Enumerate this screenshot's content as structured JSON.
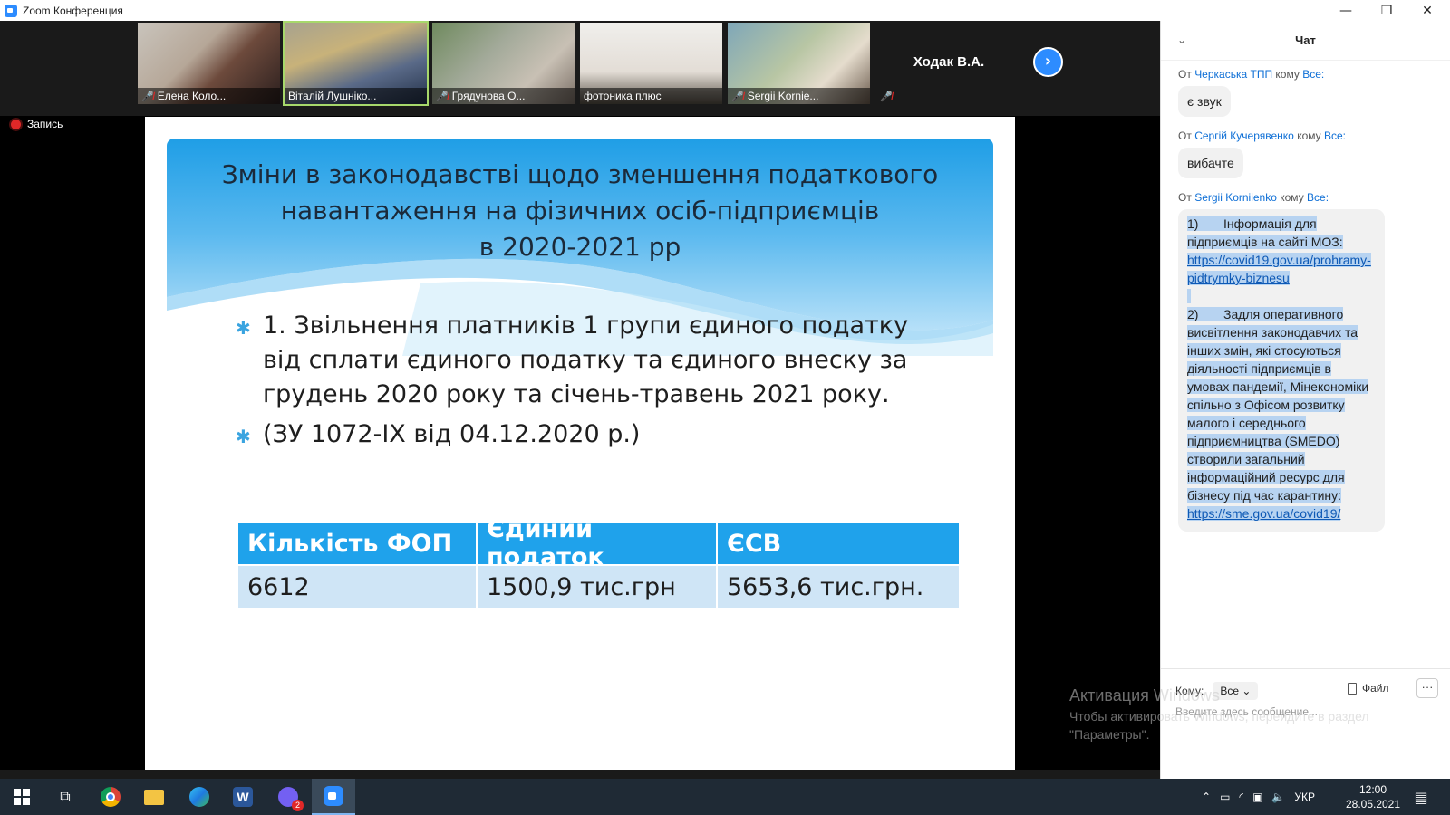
{
  "window": {
    "title": "Zoom Конференция",
    "minimize": "—",
    "maximize": "❐",
    "close": "✕"
  },
  "participants": [
    {
      "name": "Елена Коло...",
      "muted": true
    },
    {
      "name": "Віталій Лушніко...",
      "muted": false
    },
    {
      "name": "Грядунова О...",
      "muted": true
    },
    {
      "name": "фотоника плюс",
      "muted": false
    },
    {
      "name": "Sergii Kornie...",
      "muted": true
    },
    {
      "name": "Ходак В.А.",
      "muted": true
    }
  ],
  "recording": {
    "label": "Запись"
  },
  "slide": {
    "title": "Зміни в законодавстві щодо зменшення податкового\nнавантаження на фізичних осіб-підприємців\nв 2020-2021 рр",
    "bullets": [
      "1. Звільнення платників 1 групи єдиного податку від сплати єдиного податку та єдиного внеску за грудень 2020 року та січень-травень 2021 року.",
      "(ЗУ 1072-ІХ від 04.12.2020 р.)"
    ],
    "table": {
      "headers": [
        "Кількість ФОП",
        "Єдиний податок",
        "ЄСВ"
      ],
      "row": [
        "6612",
        "1500,9 тис.грн",
        "5653,6 тис.грн."
      ]
    }
  },
  "watermark": {
    "line1": "Активация Windows",
    "line2": "Чтобы активировать Windows, перейдите в раздел",
    "line3": "\"Параметры\"."
  },
  "chat": {
    "title": "Чат",
    "from_word": "От",
    "to_word": "кому",
    "to_all": "Все:",
    "messages": [
      {
        "sender": "Черкаська ТПП",
        "text": "є звук"
      },
      {
        "sender": "Сергій Кучерявенко",
        "text": "вибачте"
      },
      {
        "sender": "Sergii Korniienko"
      }
    ],
    "long_message": {
      "p1_num": "1)",
      "p1_text": "Інформація для підприємців на сайті МОЗ:",
      "p1_link": "https://covid19.gov.ua/prohramy-pidtrymky-biznesu",
      "p2_num": "2)",
      "p2_text": "Задля оперативного висвітлення законодавчих та інших змін, які стосуються діяльності підприємців в умовах пандемії, Мінекономіки спільно з Офісом розвитку малого і середнього підприємництва (SMEDO) створили загальний інформаційний ресурс для бізнесу під час карантину:",
      "p2_link": "https://sme.gov.ua/covid19/"
    },
    "to_label": "Кому:",
    "to_value": "Все",
    "file_label": "Файл",
    "more_label": "···",
    "input_placeholder": "Введите здесь сообщение..."
  },
  "taskbar": {
    "lang": "УКР",
    "time": "12:00",
    "date": "28.05.2021",
    "viber_badge": "2"
  }
}
